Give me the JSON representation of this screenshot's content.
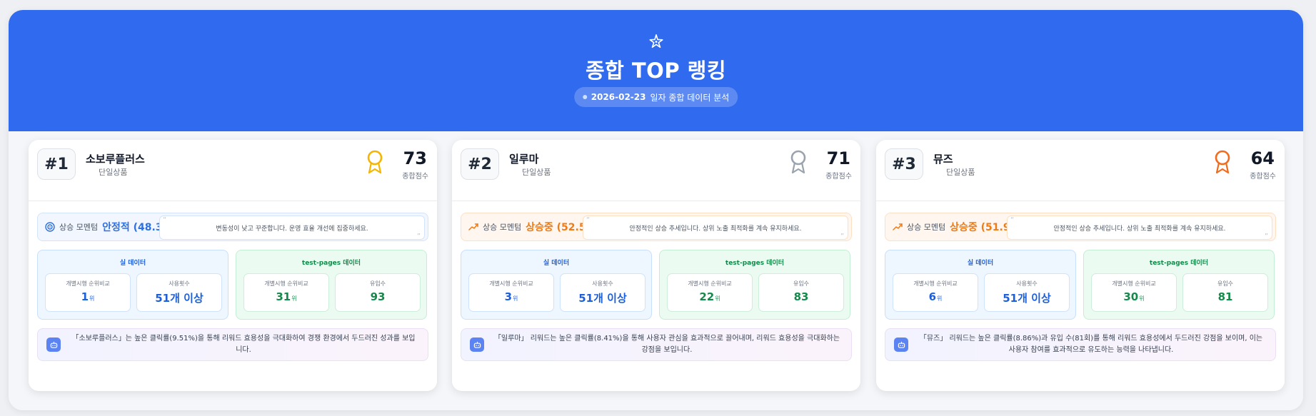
{
  "header": {
    "title": "종합 TOP 랭킹",
    "date": "2026-02-23",
    "subtitle_suffix": "일자 종합 데이터 분석",
    "icon": "sparkle-icon"
  },
  "colors": {
    "header_bg": "#2f6aef",
    "gold": "#f4b400",
    "silver": "#9aa3ad",
    "bronze": "#f26b1d",
    "real_accent": "#1d5fd8",
    "test_accent": "#138a4a",
    "stable": "#2f6fe0",
    "rising": "#f07a14"
  },
  "cards": [
    {
      "rank": "#1",
      "name": "소보루플러스",
      "type": "단일상품",
      "medal": "gold-medal-icon",
      "score": "73",
      "score_label": "종합점수",
      "momentum_label": "상승 모멘텀",
      "momentum_value": "안정적 (48.3)",
      "momentum_icon": "target-icon",
      "momentum_quote": "변동성이 낮고 꾸준합니다. 운영 효율 개선에 집중하세요.",
      "real_title": "실 데이터",
      "real_rank_label": "개별시행 순위비교",
      "real_rank_value": "1",
      "real_rank_unit": "위",
      "real_usage_label": "사용횟수",
      "real_usage_value": "51개 이상",
      "test_title": "test-pages 데이터",
      "test_rank_label": "개별시행 순위비교",
      "test_rank_value": "31",
      "test_rank_unit": "위",
      "test_inflow_label": "유입수",
      "test_inflow_value": "93",
      "insight": "「소보루플러스」는 높은 클릭률(9.51%)을 통해 리워드 효용성을 극대화하여 경쟁 환경에서 두드러진 성과를 보입니다."
    },
    {
      "rank": "#2",
      "name": "일루마",
      "type": "단일상품",
      "medal": "silver-medal-icon",
      "score": "71",
      "score_label": "종합점수",
      "momentum_label": "상승 모멘텀",
      "momentum_value": "상승중 (52.5)",
      "momentum_icon": "trending-up-icon",
      "momentum_quote": "안정적인 상승 추세입니다. 상위 노출 최적화를 계속 유지하세요.",
      "real_title": "실 데이터",
      "real_rank_label": "개별시행 순위비교",
      "real_rank_value": "3",
      "real_rank_unit": "위",
      "real_usage_label": "사용횟수",
      "real_usage_value": "51개 이상",
      "test_title": "test-pages 데이터",
      "test_rank_label": "개별시행 순위비교",
      "test_rank_value": "22",
      "test_rank_unit": "위",
      "test_inflow_label": "유입수",
      "test_inflow_value": "83",
      "insight": "「일루마」 리워드는 높은 클릭률(8.41%)을 통해 사용자 관심을 효과적으로 끌어내며, 리워드 효용성을 극대화하는 강점을 보입니다."
    },
    {
      "rank": "#3",
      "name": "뮤즈",
      "type": "단일상품",
      "medal": "bronze-medal-icon",
      "score": "64",
      "score_label": "종합점수",
      "momentum_label": "상승 모멘텀",
      "momentum_value": "상승중 (51.9)",
      "momentum_icon": "trending-up-icon",
      "momentum_quote": "안정적인 상승 추세입니다. 상위 노출 최적화를 계속 유지하세요.",
      "real_title": "실 데이터",
      "real_rank_label": "개별시행 순위비교",
      "real_rank_value": "6",
      "real_rank_unit": "위",
      "real_usage_label": "사용횟수",
      "real_usage_value": "51개 이상",
      "test_title": "test-pages 데이터",
      "test_rank_label": "개별시행 순위비교",
      "test_rank_value": "30",
      "test_rank_unit": "위",
      "test_inflow_label": "유입수",
      "test_inflow_value": "81",
      "insight": "「뮤즈」 리워드는 높은 클릭률(8.86%)과 유입 수(81회)를 통해 리워드 효용성에서 두드러진 강점을 보이며, 이는 사용자 참여를 효과적으로 유도하는 능력을 나타냅니다."
    }
  ]
}
